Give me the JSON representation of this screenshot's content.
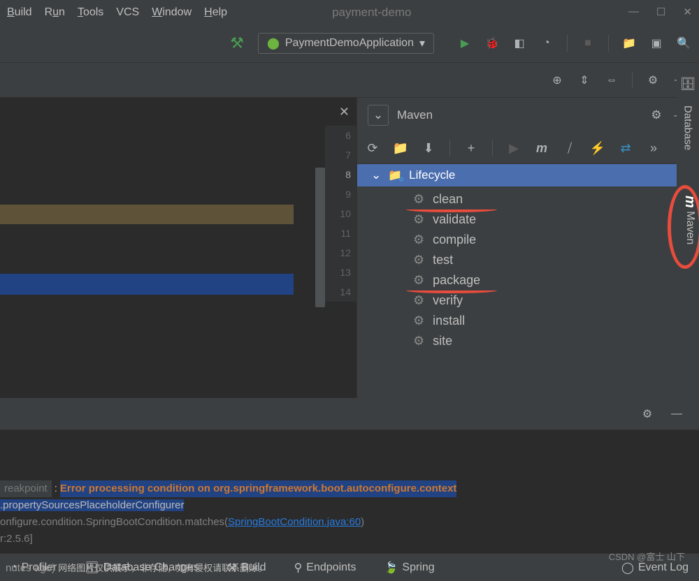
{
  "menu": {
    "build": "Build",
    "run": "Run",
    "tools": "Tools",
    "vcs": "VCS",
    "window": "Window",
    "help": "Help"
  },
  "title": "payment-demo",
  "runConfig": "PaymentDemoApplication",
  "maven": {
    "panelTitle": "Maven",
    "lifecycleLabel": "Lifecycle",
    "items": [
      "clean",
      "validate",
      "compile",
      "test",
      "package",
      "verify",
      "install",
      "site"
    ]
  },
  "gutter": [
    "6",
    "7",
    "8",
    "9",
    "10",
    "11",
    "12",
    "13",
    "14"
  ],
  "sidebar": {
    "database": "Database",
    "maven": "Maven"
  },
  "console": {
    "breakpoint": "reakpoint",
    "error1": "Error processing condition on org.springframework.boot.autoconfigure.context",
    "error2": ".propertySourcesPlaceholderConfigurer",
    "line3a": "onfigure.condition.SpringBootCondition.matches(",
    "line3b": "SpringBootCondition.java:60",
    "line3c": ")",
    "line4": "r:2.5.6]"
  },
  "bottomBar": {
    "profiler": "Profiler",
    "dbChanges": "Database Changes",
    "build": "Build",
    "endpoints": "Endpoints",
    "spring": "Spring",
    "eventLog": "Event Log"
  },
  "watermark": "CSDN @富士 山下",
  "faded": "nutes ago)",
  "fadedCn": "网络图片仅供展示，非存储，如有侵权请联系删除。"
}
